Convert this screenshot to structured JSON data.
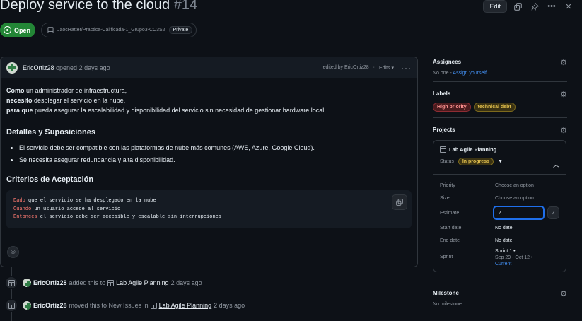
{
  "issue": {
    "title": "Deploy service to the cloud",
    "number": "#14",
    "edit_label": "Edit",
    "state": "Open",
    "repo": "JaocHatter/Practica-Calificada-1_Grupo3-CC3S2",
    "visibility": "Private"
  },
  "comment": {
    "author": "EricOrtiz28",
    "action": "opened 2 days ago",
    "edited": "edited by EricOrtiz28",
    "edits_label": "Edits",
    "lines": [
      {
        "bold": "Como",
        "text": " un administrador de infraestructura,"
      },
      {
        "bold": "necesito",
        "text": " desplegar el servicio en la nube,"
      },
      {
        "bold": "para que",
        "text": " pueda asegurar la escalabilidad y disponibilidad del servicio sin necesidad de gestionar hardware local."
      }
    ],
    "heading1": "Detalles y Suposiciones",
    "bullets": [
      "El servicio debe ser compatible con las plataformas de nube más comunes (AWS, Azure, Google Cloud).",
      "Se necesita asegurar redundancia y alta disponibilidad."
    ],
    "heading2": "Criterios de Aceptación",
    "code": [
      {
        "kw": "Dado",
        "text": " que el servicio se ha desplegado en la nube"
      },
      {
        "kw": "Cuando",
        "text": " un usuario accede al servicio"
      },
      {
        "kw": "Entonces",
        "text": " el servicio debe ser accesible y escalable sin interrupciones"
      }
    ]
  },
  "timeline": [
    {
      "author": "EricOrtiz28",
      "pre": "added this to",
      "link": "Lab Agile Planning",
      "time": "2 days ago"
    },
    {
      "author": "EricOrtiz28",
      "pre": "moved this to New Issues in",
      "link": "Lab Agile Planning",
      "time": "2 days ago"
    }
  ],
  "sidebar": {
    "assignees": {
      "title": "Assignees",
      "none": "No one - ",
      "assign": "Assign yourself"
    },
    "labels": {
      "title": "Labels",
      "items": [
        {
          "name": "High priority",
          "color": "#f85149"
        },
        {
          "name": "technical debt",
          "color": "#d4a72c"
        }
      ]
    },
    "projects": {
      "title": "Projects",
      "name": "Lab Agile Planning",
      "status_label": "Status",
      "status": "In progress",
      "fields": [
        {
          "key": "Priority",
          "value": "Choose an option"
        },
        {
          "key": "Size",
          "value": "Choose an option"
        },
        {
          "key": "Estimate",
          "value": "2"
        },
        {
          "key": "Start date",
          "value": "No date"
        },
        {
          "key": "End date",
          "value": "No date"
        }
      ],
      "sprint": {
        "key": "Sprint",
        "name": "Sprint 1 •",
        "dates": "Sep 29 - Oct 12 •",
        "current": "Current"
      }
    },
    "milestone": {
      "title": "Milestone",
      "none": "No milestone"
    }
  }
}
